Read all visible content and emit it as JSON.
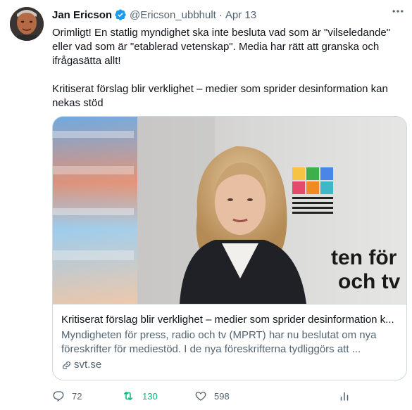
{
  "author": {
    "name": "Jan Ericson",
    "handle": "@Ericson_ubbhult",
    "separator": "·",
    "date": "Apr 13"
  },
  "tweet": {
    "paragraph1": "Orimligt! En statlig myndighet ska inte  besluta vad som är \"vilseledande\" eller vad som är \"etablerad vetenskap\". Media har rätt att granska och ifrågasätta allt!",
    "paragraph2": "Kritiserat förslag blir verklighet – medier som sprider desinformation kan nekas stöd"
  },
  "card": {
    "image_text_line1": "ten för",
    "image_text_line2": "och tv",
    "title": "Kritiserat förslag blir verklighet – medier som sprider desinformation k...",
    "description": "Myndigheten för press, radio och tv (MPRT) har nu beslutat om nya föreskrifter för mediestöd. I de nya föreskrifterna tydliggörs att ...",
    "domain": "svt.se"
  },
  "actions": {
    "replies": "72",
    "retweets": "130",
    "likes": "598"
  },
  "colors": {
    "verified": "#1d9bf0",
    "retweet_active": "#00ba7c",
    "secondary_text": "#536471"
  },
  "icons": [
    "verified-badge-icon",
    "more-icon",
    "link-icon",
    "reply-icon",
    "retweet-icon",
    "like-icon",
    "analytics-icon"
  ]
}
